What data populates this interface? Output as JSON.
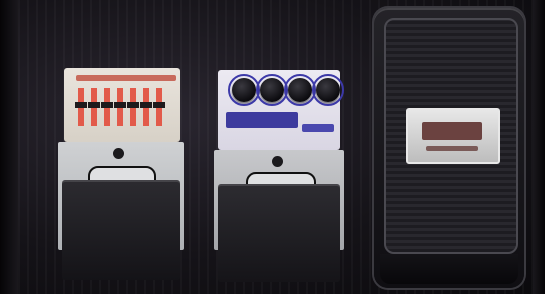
{
  "scene": {
    "objects": [
      "eq-pedal",
      "knob-pedal",
      "expression-pedal"
    ]
  }
}
